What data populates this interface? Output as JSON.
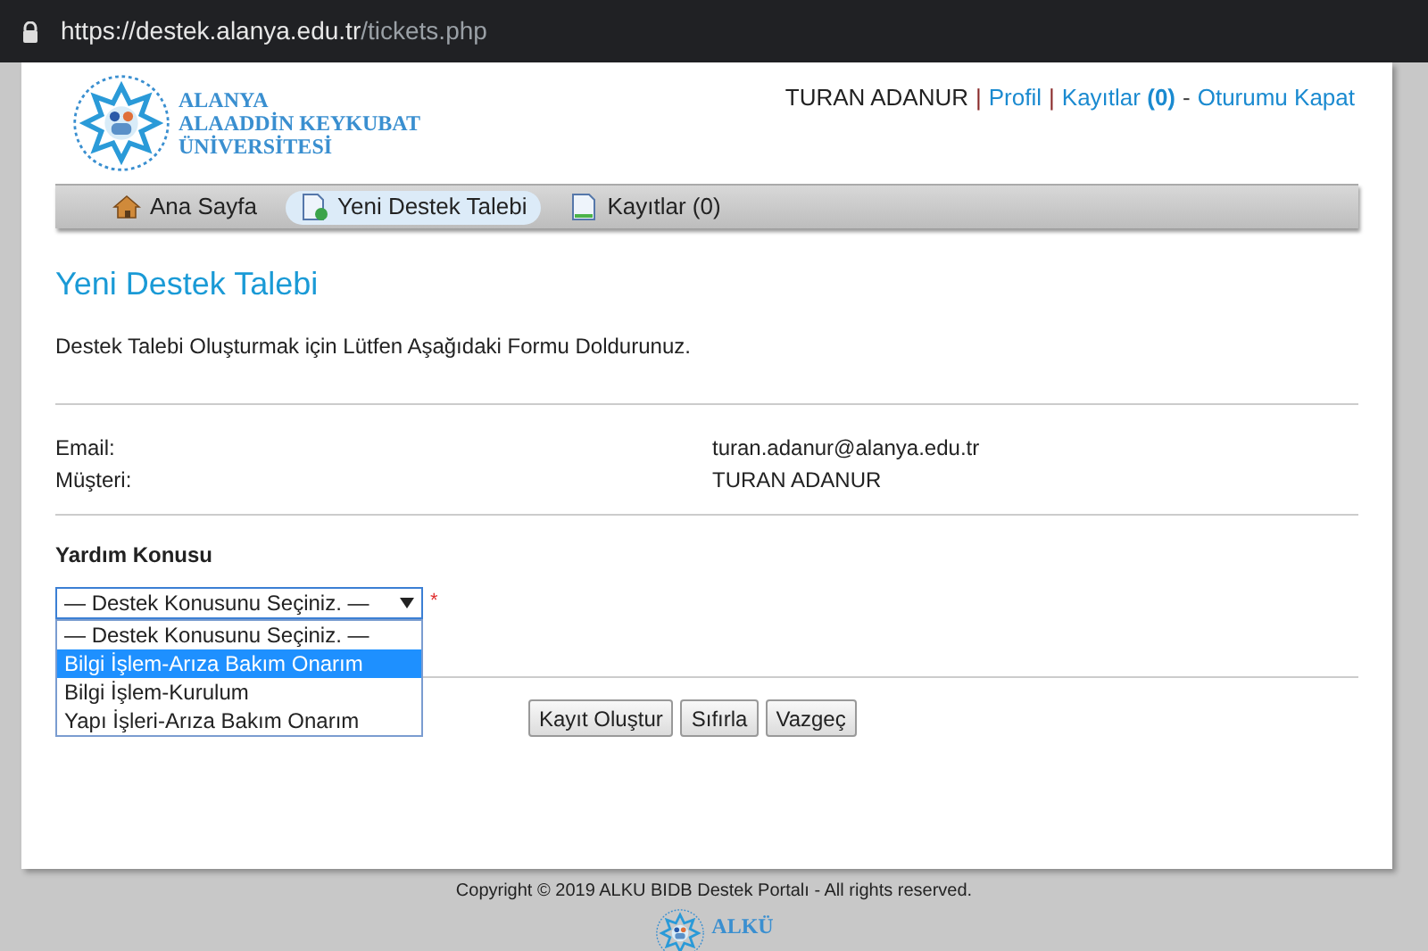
{
  "address_bar": {
    "host": "https://destek.alanya.edu.tr",
    "path": "/tickets.php"
  },
  "logo": {
    "lines": [
      "ALANYA",
      "ALAADDİN KEYKUBAT",
      "ÜNİVERSİTESİ"
    ]
  },
  "user_bar": {
    "name": "TURAN ADANUR",
    "links": [
      {
        "label": "Profil",
        "separator": "|"
      },
      {
        "label": "Kayıtlar",
        "count": "(0)",
        "separator": "|"
      },
      {
        "label": "Oturumu Kapat",
        "separator": "-"
      }
    ]
  },
  "nav": [
    {
      "label": "Ana Sayfa",
      "kind": "home",
      "selected": false
    },
    {
      "label": "Yeni Destek Talebi",
      "kind": "new",
      "selected": true
    },
    {
      "label": "Kayıtlar (0)",
      "kind": "doc",
      "selected": false
    }
  ],
  "page_title": "Yeni Destek Talebi",
  "intro": "Destek Talebi Oluşturmak için Lütfen Aşağıdaki Formu Doldurunuz.",
  "info": [
    {
      "label": "Email:",
      "value": "turan.adanur@alanya.edu.tr"
    },
    {
      "label": "Müşteri:",
      "value": "TURAN ADANUR"
    }
  ],
  "topic": {
    "label": "Yardım Konusu",
    "value": "— Destek Konusunu Seçiniz. —",
    "required_mark": "*",
    "expanded": true,
    "options": [
      {
        "label": "— Destek Konusunu Seçiniz. —",
        "highlighted": false
      },
      {
        "label": "Bilgi İşlem-Arıza Bakım Onarım",
        "highlighted": true
      },
      {
        "label": "Bilgi İşlem-Kurulum",
        "highlighted": false
      },
      {
        "label": "Yapı İşleri-Arıza Bakım Onarım",
        "highlighted": false
      }
    ]
  },
  "buttons": [
    "Kayıt Oluştur",
    "Sıfırla",
    "Vazgeç"
  ],
  "footer": {
    "copyright": "Copyright © 2019 ALKU BIDB Destek Portalı - All rights reserved.",
    "logo_lines": [
      "ALKÜ"
    ]
  }
}
